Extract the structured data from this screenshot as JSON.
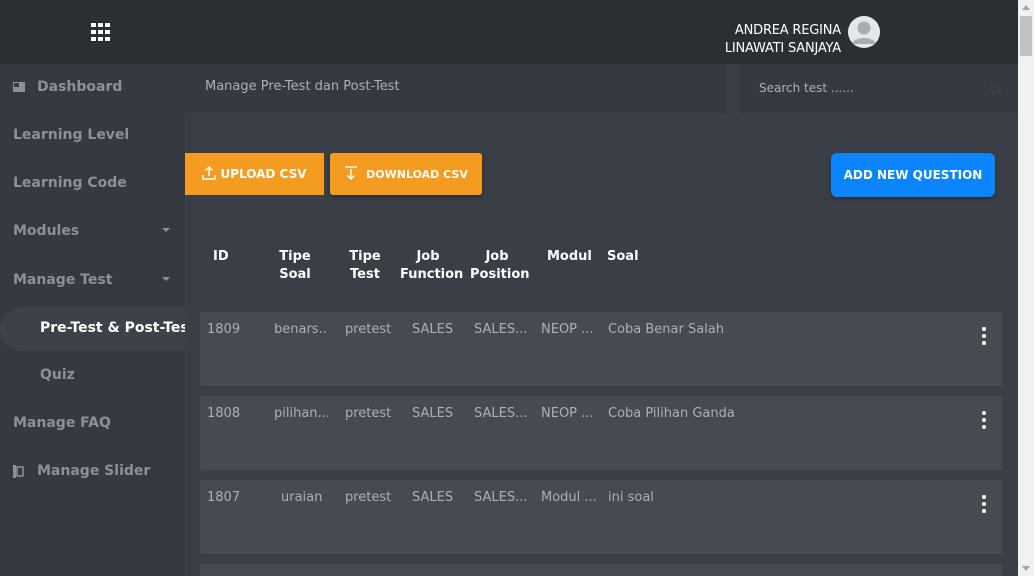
{
  "header": {
    "user_line1": "ANDREA REGINA",
    "user_line2": "LINAWATI SANJAYA",
    "menu_icon": "apps-grid-icon",
    "avatar_icon": "user-avatar-icon"
  },
  "sidebar": {
    "items": [
      {
        "label": "Dashboard",
        "icon": "dashboard-icon"
      },
      {
        "label": "Learning Level"
      },
      {
        "label": "Learning Code"
      },
      {
        "label": "Modules",
        "has_caret": true
      },
      {
        "label": "Manage Test",
        "has_caret": true
      },
      {
        "label": "Pre-Test & Post-Test",
        "active": true
      },
      {
        "label": "Quiz"
      },
      {
        "label": "Manage FAQ"
      },
      {
        "label": "Manage Slider",
        "icon": "slider-icon"
      }
    ]
  },
  "page": {
    "breadcrumb": "Manage Pre-Test dan Post-Test",
    "search_placeholder": "Search test ......"
  },
  "toolbar": {
    "upload_label": "UPLOAD CSV",
    "download_label": "DOWNLOAD CSV",
    "add_label": "ADD NEW QUESTION"
  },
  "table": {
    "headers": {
      "id": "ID",
      "tipe_soal_1": "Tipe",
      "tipe_soal_2": "Soal",
      "tipe_test_1": "Tipe",
      "tipe_test_2": "Test",
      "job_function_1": "Job",
      "job_function_2": "Function",
      "job_position_1": "Job",
      "job_position_2": "Position",
      "modul": "Modul",
      "soal": "Soal"
    },
    "rows": [
      {
        "id": "1809",
        "tipe_soal": "benars...",
        "tipe_test": "pretest",
        "job_function": "SALES",
        "job_position": "SALES...",
        "modul": "NEOP ...",
        "soal": "Coba Benar Salah"
      },
      {
        "id": "1808",
        "tipe_soal": "pilihan...",
        "tipe_test": "pretest",
        "job_function": "SALES",
        "job_position": "SALES...",
        "modul": "NEOP ...",
        "soal": "Coba Pilihan Ganda"
      },
      {
        "id": "1807",
        "tipe_soal": "uraian",
        "tipe_test": "pretest",
        "job_function": "SALES",
        "job_position": "SALES...",
        "modul": "Modul ...",
        "soal": "ini soal"
      }
    ]
  },
  "colors": {
    "topbar": "#2a2f33",
    "sidebar": "#343a40",
    "accent_orange": "#f39c1f",
    "accent_blue": "#0a84ff"
  }
}
